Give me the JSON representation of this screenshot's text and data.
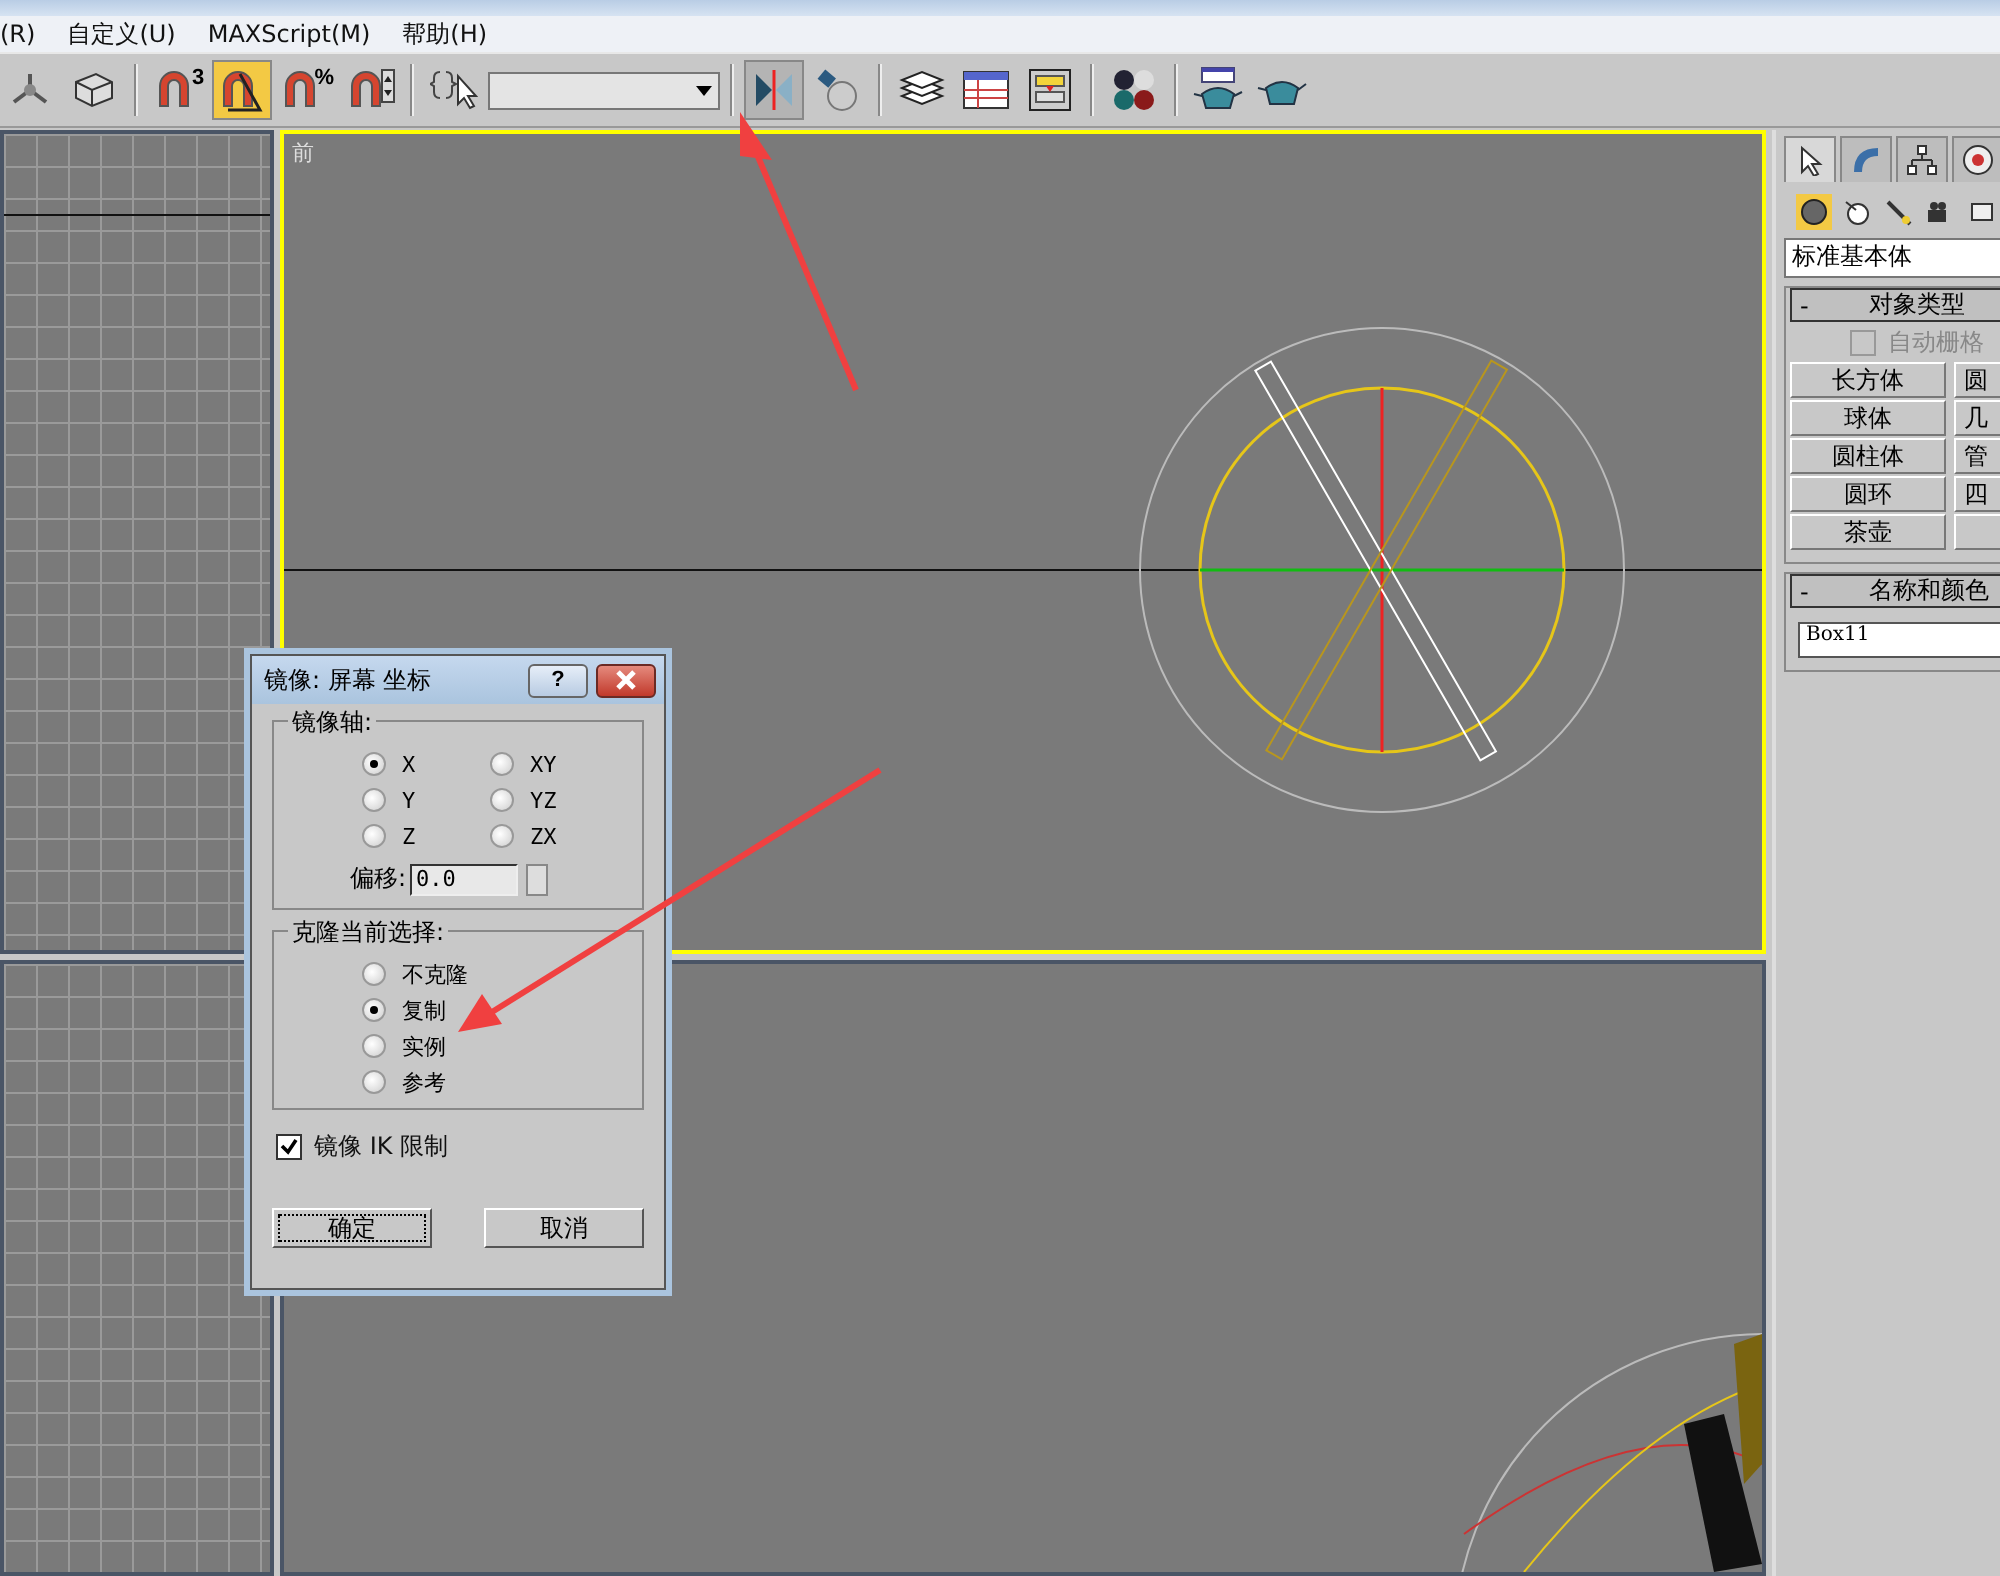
{
  "menu": [
    "(R)",
    "自定义(U)",
    "MAXScript(M)",
    "帮助(H)"
  ],
  "toolbar": [
    {
      "kind": "button",
      "selected": false
    },
    {
      "kind": "button",
      "selected": false
    },
    {
      "kind": "separator"
    },
    {
      "kind": "button",
      "selected": false,
      "badge": "3"
    },
    {
      "kind": "button",
      "selected": true
    },
    {
      "kind": "button",
      "selected": false,
      "badge": "%"
    },
    {
      "kind": "button",
      "selected": false
    },
    {
      "kind": "separator"
    },
    {
      "kind": "button",
      "selected": false
    },
    {
      "kind": "dropdown"
    },
    {
      "kind": "separator"
    },
    {
      "kind": "button",
      "selected": true
    },
    {
      "kind": "button",
      "selected": false
    },
    {
      "kind": "separator"
    },
    {
      "kind": "button",
      "selected": false
    },
    {
      "kind": "button",
      "selected": false
    },
    {
      "kind": "button",
      "selected": false
    },
    {
      "kind": "separator"
    },
    {
      "kind": "button",
      "selected": false
    },
    {
      "kind": "separator"
    },
    {
      "kind": "button",
      "selected": false
    },
    {
      "kind": "button",
      "selected": false
    }
  ],
  "viewports": {
    "front": {
      "label": "前",
      "selected": true
    }
  },
  "command_panel": {
    "tabs": [
      {
        "selected": true
      },
      {
        "selected": false
      },
      {
        "selected": false
      },
      {
        "selected": false
      }
    ],
    "categories": [
      {
        "selected": true
      },
      {
        "selected": false
      },
      {
        "selected": false
      },
      {
        "selected": false
      },
      {
        "selected": false
      }
    ],
    "dropdown": "标准基本体",
    "object_type": {
      "title": "对象类型",
      "autogrid": {
        "label": "自动栅格",
        "checked": false,
        "disabled": true
      },
      "collapse": "-",
      "buttons": [
        {
          "left": "长方体",
          "right": "圆"
        },
        {
          "left": "球体",
          "right": "几"
        },
        {
          "left": "圆柱体",
          "right": "管"
        },
        {
          "left": "圆环",
          "right": "四"
        },
        {
          "left": "茶壶"
        }
      ]
    },
    "name_color": {
      "title": "名称和颜色",
      "collapse": "-",
      "name": "Box11"
    }
  },
  "dialog": {
    "title": "镜像: 屏幕 坐标",
    "help": "?",
    "axis_group": "镜像轴:",
    "axes": [
      {
        "label": "X",
        "selected": true
      },
      {
        "label": "XY",
        "selected": false
      },
      {
        "label": "Y",
        "selected": false
      },
      {
        "label": "YZ",
        "selected": false
      },
      {
        "label": "Z",
        "selected": false
      },
      {
        "label": "ZX",
        "selected": false
      }
    ],
    "offset": {
      "label": "偏移:",
      "value": "0.0"
    },
    "clone_group": "克隆当前选择:",
    "clone": [
      {
        "label": "不克隆",
        "selected": false
      },
      {
        "label": "复制",
        "selected": true
      },
      {
        "label": "实例",
        "selected": false
      },
      {
        "label": "参考",
        "selected": false
      }
    ],
    "ik": {
      "label": "镜像 IK 限制",
      "checked": true
    },
    "buttons": [
      "确定",
      "取消"
    ]
  }
}
